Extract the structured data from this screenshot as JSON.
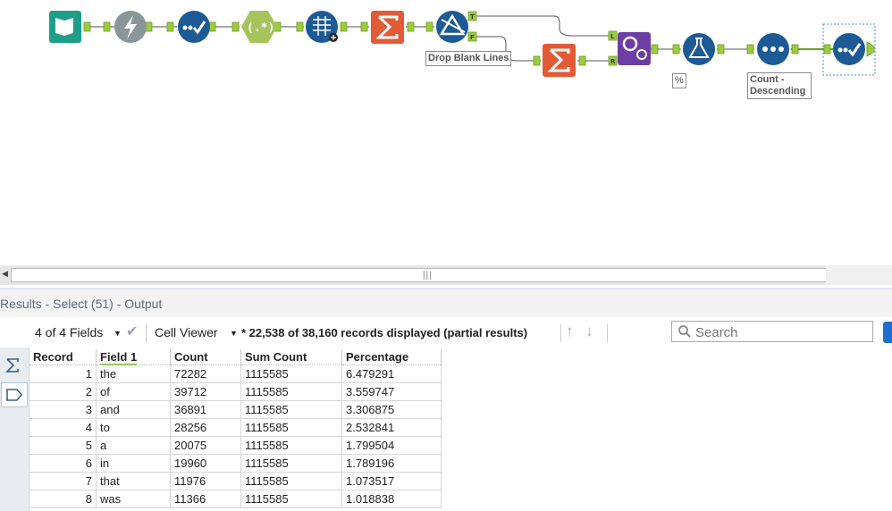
{
  "workflow": {
    "annotations": {
      "drop_blank": "Drop Blank Lines",
      "percent": "%",
      "sort_line1": "Count -",
      "sort_line2": "Descending"
    },
    "filter_anchors": {
      "true_label": "T",
      "false_label": "F"
    },
    "join_anchors": {
      "left_label": "L",
      "right_label": "R"
    },
    "colors": {
      "input_tool": "#1e9e88",
      "parse_tool": "#8a9699",
      "select_tool": "#1d5a96",
      "regex_tool": "#a6c45b",
      "summarize_tool": "#e25a36",
      "join_tool": "#6c3ea3",
      "connector": "#9ccb3e"
    }
  },
  "scrollbar": {
    "grip": "|||"
  },
  "results": {
    "title": "Results - Select (51) - Output"
  },
  "toolbar": {
    "fields": "4 of 4 Fields",
    "viewer": "Cell Viewer",
    "status": "* 22,538 of 38,160 records displayed (partial results)",
    "search_placeholder": "Search"
  },
  "table": {
    "headers": [
      "Record",
      "Field 1",
      "Count",
      "Sum Count",
      "Percentage"
    ],
    "rows": [
      [
        "1",
        "the",
        "72282",
        "1115585",
        "6.479291"
      ],
      [
        "2",
        "of",
        "39712",
        "1115585",
        "3.559747"
      ],
      [
        "3",
        "and",
        "36891",
        "1115585",
        "3.306875"
      ],
      [
        "4",
        "to",
        "28256",
        "1115585",
        "2.532841"
      ],
      [
        "5",
        "a",
        "20075",
        "1115585",
        "1.799504"
      ],
      [
        "6",
        "in",
        "19960",
        "1115585",
        "1.789196"
      ],
      [
        "7",
        "that",
        "11976",
        "1115585",
        "1.073517"
      ],
      [
        "8",
        "was",
        "11366",
        "1115585",
        "1.018838"
      ]
    ]
  }
}
